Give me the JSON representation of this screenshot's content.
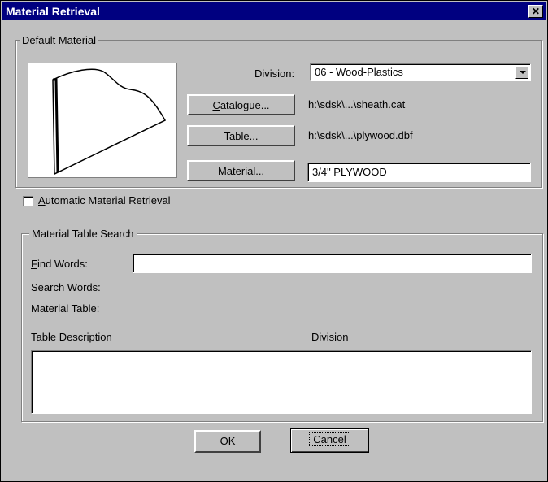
{
  "window": {
    "title": "Material Retrieval",
    "close_glyph": "✕"
  },
  "default_material": {
    "group_label": "Default Material",
    "division_label": "Division:",
    "division_value": "06 - Wood-Plastics",
    "catalogue_button": {
      "mnemonic": "C",
      "rest": "atalogue..."
    },
    "catalogue_path": "h:\\sdsk\\...\\sheath.cat",
    "table_button": {
      "mnemonic": "T",
      "rest": "able..."
    },
    "table_path": "h:\\sdsk\\...\\plywood.dbf",
    "material_button": {
      "mnemonic": "M",
      "rest": "aterial..."
    },
    "material_value": "3/4\" PLYWOOD"
  },
  "auto_retrieval": {
    "mnemonic": "A",
    "rest": "utomatic Material Retrieval",
    "checked": false
  },
  "search": {
    "group_label": "Material Table Search",
    "find_words": {
      "mnemonic": "F",
      "rest": "ind Words:"
    },
    "find_value": "",
    "search_words_label": "Search Words:",
    "material_table_label": "Material Table:",
    "col_description": "Table Description",
    "col_division": "Division"
  },
  "buttons": {
    "ok": "OK",
    "cancel": "Cancel"
  }
}
